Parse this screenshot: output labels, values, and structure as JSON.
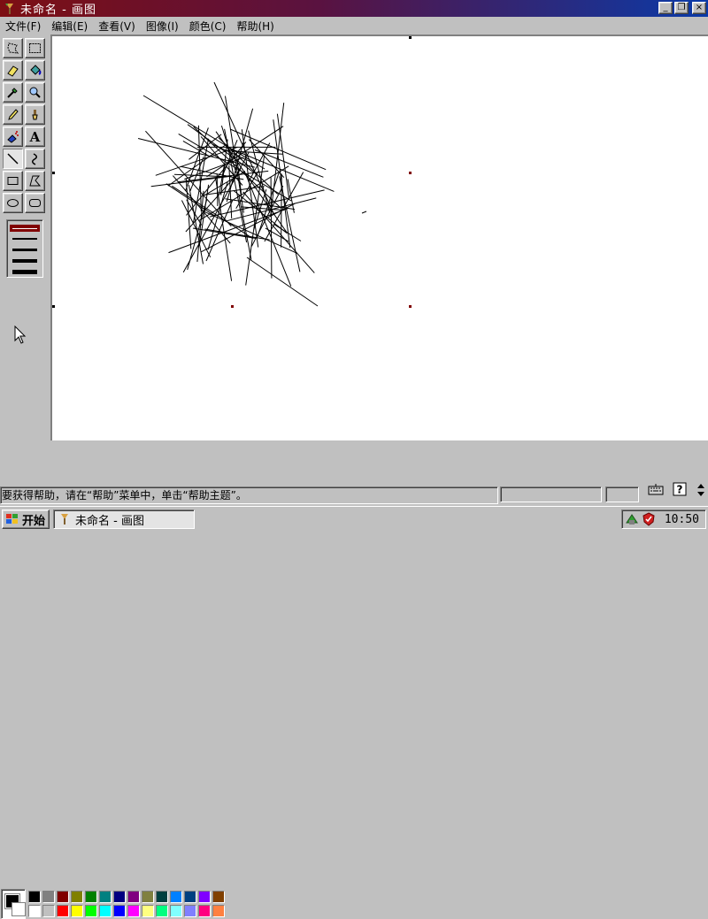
{
  "window": {
    "title": "未命名 - 画图"
  },
  "title_buttons": {
    "minimize": "_",
    "restore": "❐",
    "close": "×"
  },
  "menu": [
    {
      "label": "文件(F)"
    },
    {
      "label": "编辑(E)"
    },
    {
      "label": "查看(V)"
    },
    {
      "label": "图像(I)"
    },
    {
      "label": "颜色(C)"
    },
    {
      "label": "帮助(H)"
    }
  ],
  "tools": [
    "free-form-select",
    "select",
    "eraser",
    "fill",
    "color-picker",
    "magnifier",
    "pencil",
    "brush",
    "airbrush",
    "text",
    "line",
    "curve",
    "rectangle",
    "polygon",
    "ellipse",
    "rounded-rectangle"
  ],
  "active_tool": "line",
  "text_tool_glyph": "A",
  "palette": {
    "foreground": "#000000",
    "background": "#ffffff",
    "row1": [
      "#000000",
      "#808080",
      "#800000",
      "#808000",
      "#008000",
      "#008080",
      "#000080",
      "#800080",
      "#808040",
      "#004040",
      "#0080ff",
      "#004080",
      "#8000ff",
      "#804000"
    ],
    "row2": [
      "#ffffff",
      "#c0c0c0",
      "#ff0000",
      "#ffff00",
      "#00ff00",
      "#00ffff",
      "#0000ff",
      "#ff00ff",
      "#ffff80",
      "#00ff80",
      "#80ffff",
      "#8080ff",
      "#ff0080",
      "#ff8040"
    ]
  },
  "status": {
    "text": "要获得帮助，请在“帮助”菜单中，单击“帮助主题”。"
  },
  "taskbar": {
    "start_label": "开始",
    "task_label": "未命名 - 画图",
    "clock": "10:50"
  }
}
